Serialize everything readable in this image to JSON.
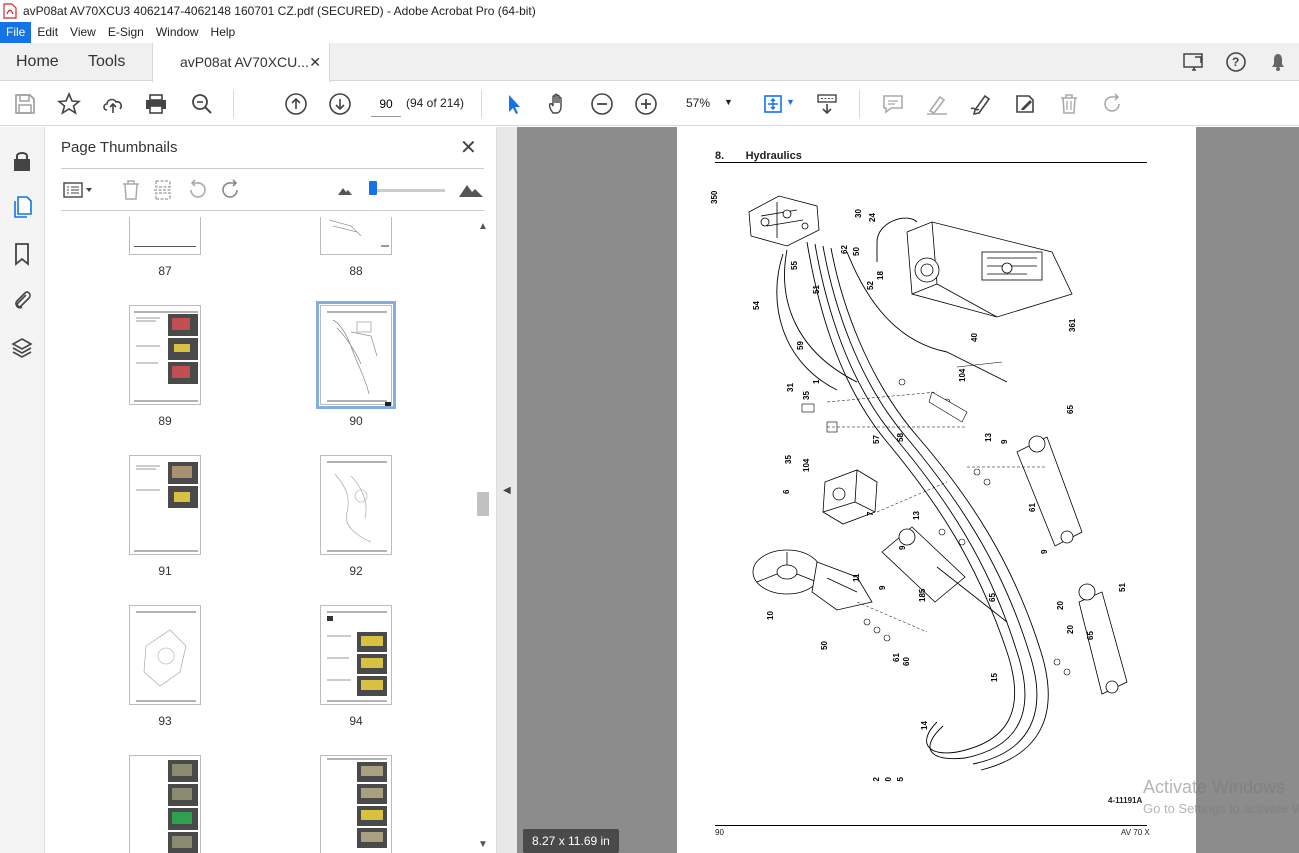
{
  "window": {
    "title": "avP08at AV70XCU3 4062147-4062148 160701 CZ.pdf (SECURED) - Adobe Acrobat Pro (64-bit)"
  },
  "menu": {
    "items": [
      "File",
      "Edit",
      "View",
      "E-Sign",
      "Window",
      "Help"
    ]
  },
  "tabs": {
    "home": "Home",
    "tools": "Tools",
    "doc": "avP08at AV70XCU..."
  },
  "toolbar": {
    "page_value": "90",
    "page_count": "(94 of 214)",
    "zoom": "57%"
  },
  "panel": {
    "title": "Page Thumbnails"
  },
  "thumbnails": [
    {
      "label": "87"
    },
    {
      "label": "88"
    },
    {
      "label": "89"
    },
    {
      "label": "90"
    },
    {
      "label": "91"
    },
    {
      "label": "92"
    },
    {
      "label": "93"
    },
    {
      "label": "94"
    }
  ],
  "pdf": {
    "section": "8.       Hydraulics",
    "figure_ref": "4-11191A",
    "footer_left": "90",
    "footer_right": "AV 70 X",
    "callouts": [
      "350",
      "55",
      "54",
      "62",
      "51",
      "50",
      "30",
      "24",
      "52",
      "18",
      "59",
      "361",
      "40",
      "104",
      "35",
      "31",
      "1",
      "57",
      "58",
      "13",
      "9",
      "65",
      "104",
      "35",
      "6",
      "7",
      "61",
      "9",
      "13",
      "9",
      "14",
      "11",
      "9",
      "185",
      "10",
      "50",
      "61",
      "60",
      "65",
      "15",
      "20",
      "20",
      "65",
      "51",
      "62",
      "60",
      "55",
      "54"
    ]
  },
  "size_badge": "8.27 x 11.69 in",
  "watermark": {
    "line1": "Activate Windows",
    "line2": "Go to Settings to activate Windows."
  },
  "colors": {
    "accent": "#1473e6",
    "viewer_bg": "#8c8c8c"
  }
}
